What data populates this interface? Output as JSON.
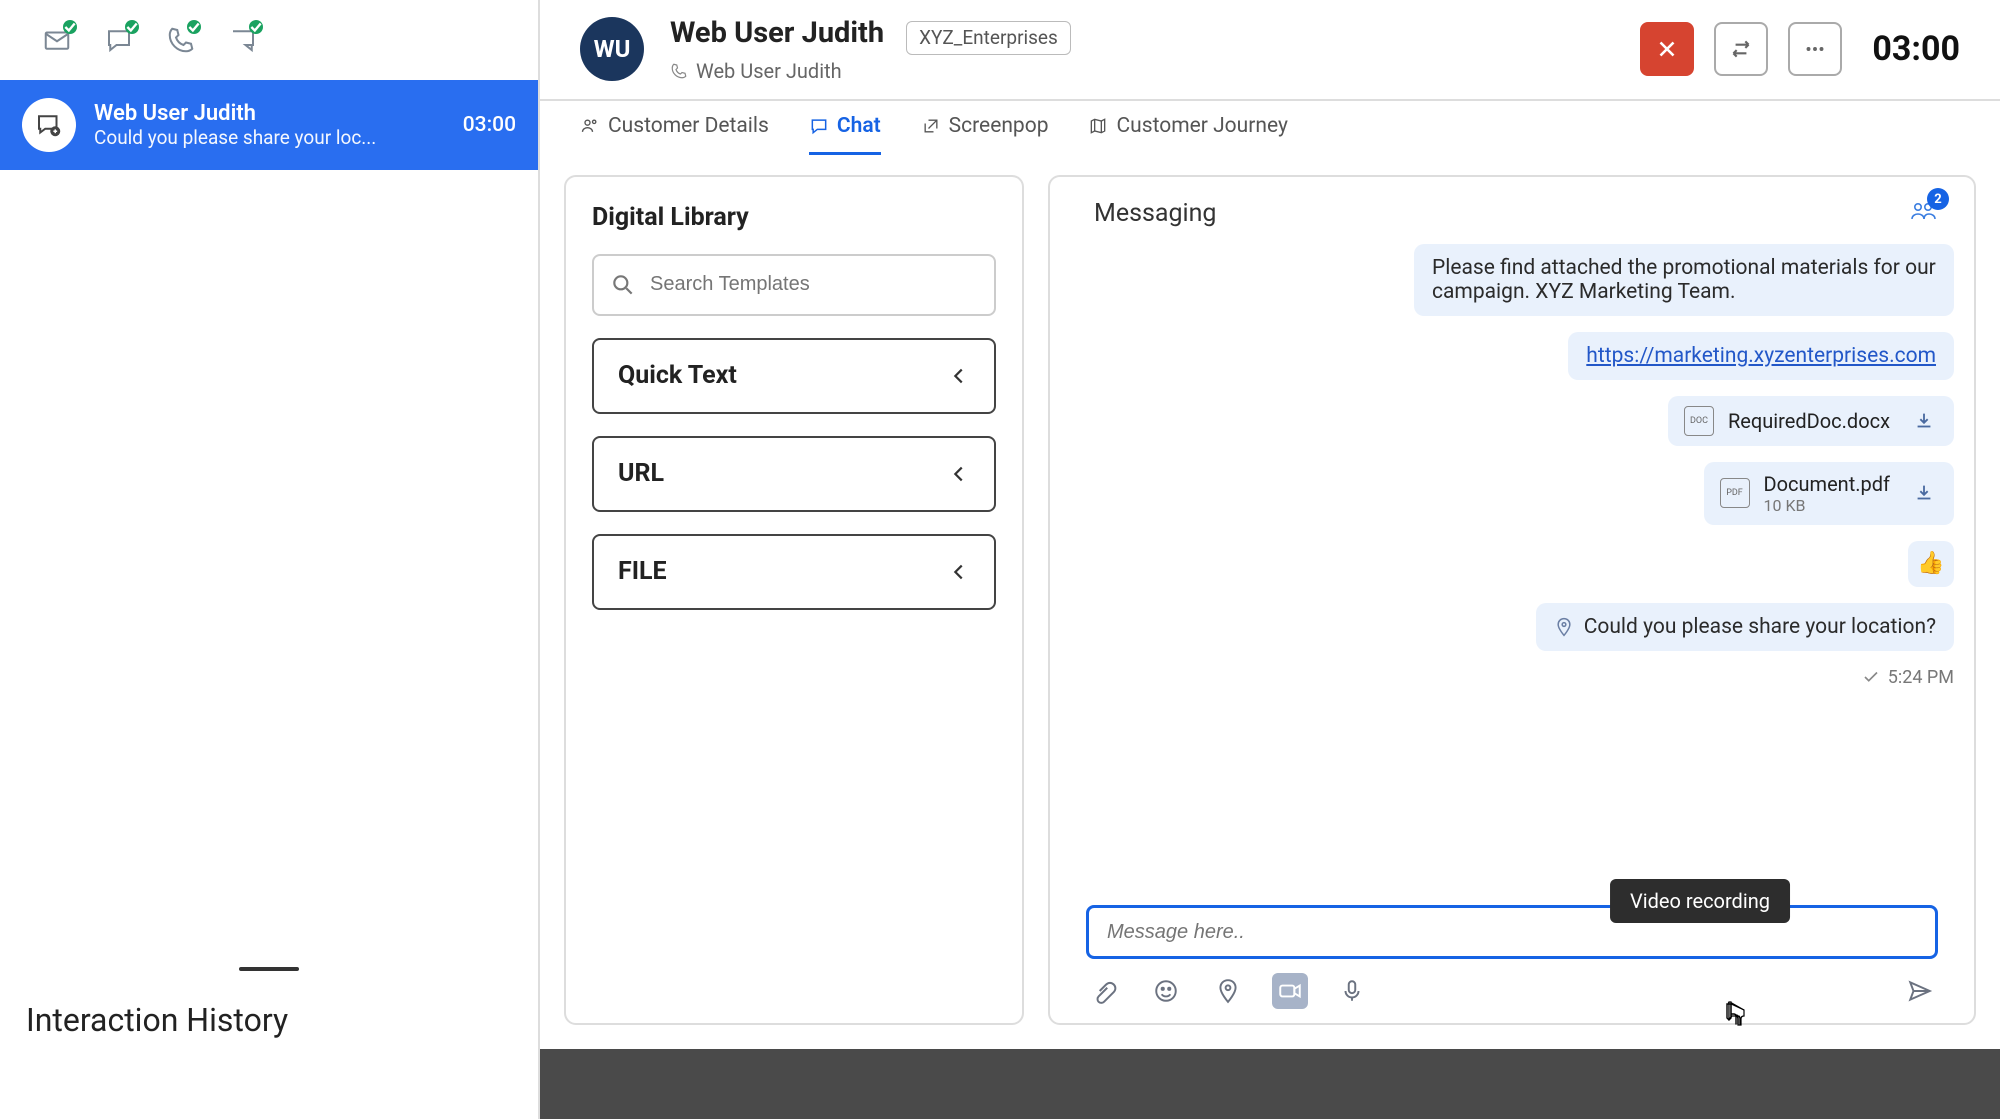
{
  "sidebar": {
    "icons": [
      "mail",
      "chat",
      "phone",
      "chat-out"
    ],
    "conversation": {
      "title": "Web User Judith",
      "preview": "Could you please share your loc...",
      "time": "03:00"
    },
    "interaction_history_label": "Interaction History"
  },
  "header": {
    "avatar_initials": "WU",
    "customer_name": "Web User Judith",
    "org_badge": "XYZ_Enterprises",
    "subtitle": "Web User Judith",
    "timer": "03:00",
    "actions": {
      "close": "Close",
      "transfer": "Transfer",
      "more": "More"
    }
  },
  "tabs": {
    "customer_details": "Customer Details",
    "chat": "Chat",
    "screenpop": "Screenpop",
    "customer_journey": "Customer Journey"
  },
  "digital_library": {
    "title": "Digital Library",
    "search_placeholder": "Search Templates",
    "rows": {
      "quick_text": "Quick Text",
      "url": "URL",
      "file": "FILE"
    }
  },
  "messaging": {
    "header": "Messaging",
    "participant_count": "2",
    "bubble_text": "Please find attached the promotional materials for our campaign. XYZ Marketing Team.",
    "link_text": "https://marketing.xyzenterprises.com",
    "attachments": [
      {
        "name": "RequiredDoc.docx",
        "ext": "DOC",
        "size": ""
      },
      {
        "name": "Document.pdf",
        "ext": "PDF",
        "size": "10 KB"
      }
    ],
    "reaction": "👍",
    "location_question": "Could you please share your location?",
    "timestamp": "5:24 PM",
    "compose_placeholder": "Message here..",
    "tooltip": "Video recording"
  }
}
